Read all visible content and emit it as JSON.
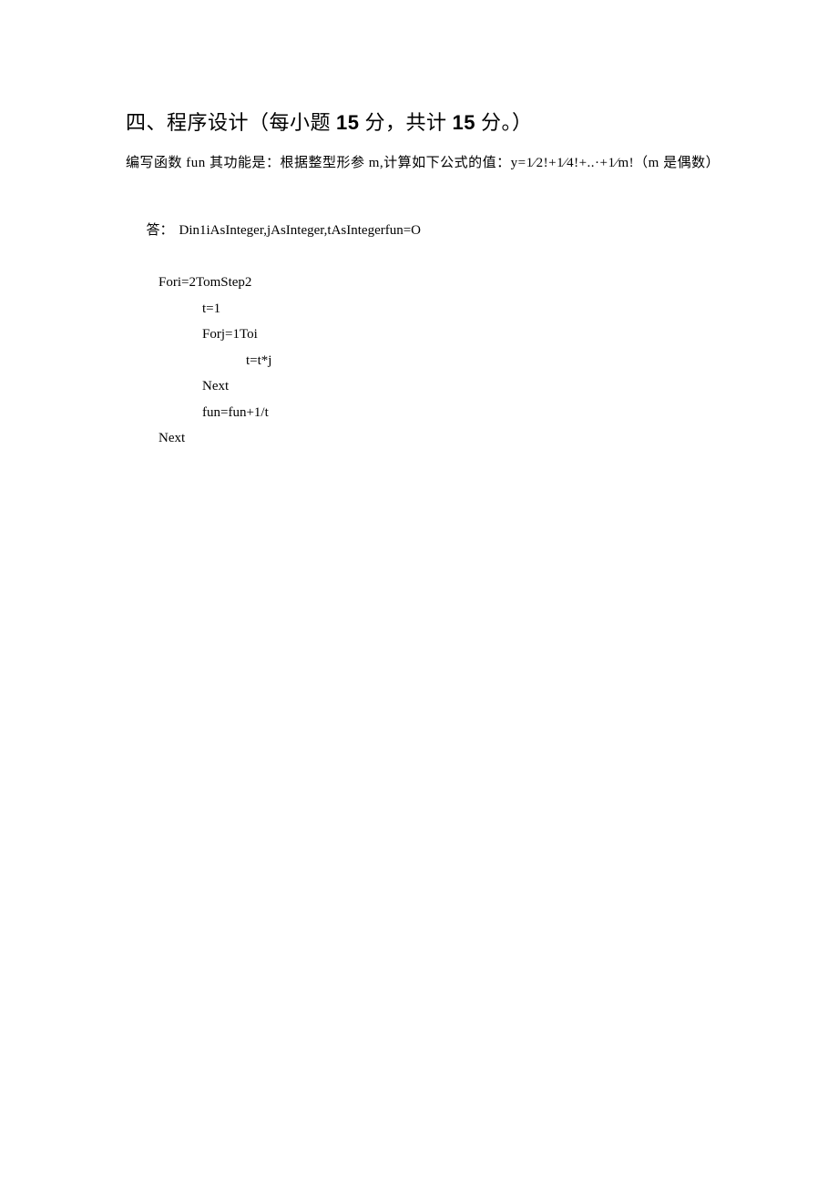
{
  "heading": {
    "prefix": "四、程序设计（每小题 ",
    "points1": "15",
    "mid": " 分，共计 ",
    "points2": "15",
    "suffix": " 分。）"
  },
  "problem": "编写函数 fun 其功能是：根据整型形参 m,计算如下公式的值：y=1⁄2!+1⁄4!+..·+1⁄m!（m 是偶数）",
  "answer": {
    "label": "答：",
    "lines": [
      {
        "indent": 0,
        "text": "Din1iAsInteger,jAsInteger,tAsIntegerfun=O"
      },
      {
        "indent": 1,
        "text": "Fori=2TomStep2"
      },
      {
        "indent": 2,
        "text": "t=1"
      },
      {
        "indent": 2,
        "text": "Forj=1Toi"
      },
      {
        "indent": 3,
        "text": "t=t*j"
      },
      {
        "indent": 2,
        "text": "Next"
      },
      {
        "indent": 2,
        "text": "fun=fun+1/t"
      },
      {
        "indent": 1,
        "text": "Next"
      }
    ]
  }
}
